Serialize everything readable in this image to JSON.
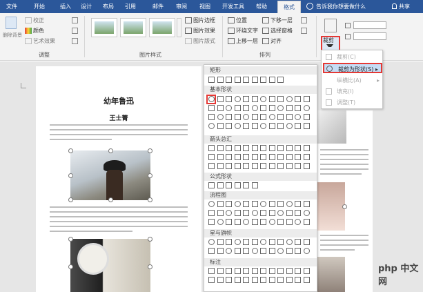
{
  "tabs": [
    "文件",
    "开始",
    "插入",
    "设计",
    "布局",
    "引用",
    "邮件",
    "审阅",
    "视图",
    "开发工具",
    "帮助",
    "格式"
  ],
  "active_tab": "格式",
  "search": {
    "placeholder": "告诉我你想要做什么"
  },
  "share_label": "共享",
  "ribbon": {
    "adjust": {
      "remove_bg": "删除背景",
      "correct": "校正",
      "color": "颜色",
      "artistic": "艺术效果",
      "label": "调整"
    },
    "picture_styles": {
      "border": "图片边框",
      "effects": "图片效果",
      "layout": "图片版式",
      "label": "图片样式"
    },
    "arrange": {
      "position": "位置",
      "wrap": "环绕文字",
      "forward": "上移一层",
      "backward": "下移一层",
      "selection": "选择窗格",
      "align": "对齐",
      "label": "排列"
    },
    "crop": {
      "label": "裁剪"
    }
  },
  "document": {
    "title": "幼年鲁迅",
    "author": "王士菁"
  },
  "watermark": "php 中文网",
  "shape_gallery": {
    "sections": [
      "矩形",
      "基本形状",
      "箭头总汇",
      "公式形状",
      "流程图",
      "星与旗帜",
      "标注"
    ]
  },
  "crop_menu": {
    "items": [
      "裁剪(C)",
      "裁剪为形状(S)",
      "纵横比(A)",
      "填充(I)",
      "调整(T)"
    ],
    "highlighted": "裁剪为形状(S)"
  },
  "colors": {
    "accent": "#2b579a",
    "highlight_border": "#e53935",
    "menu_highlight": "#c5dcf5"
  }
}
